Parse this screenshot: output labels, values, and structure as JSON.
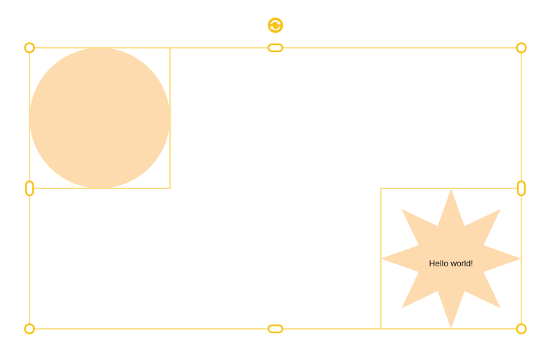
{
  "canvas": {
    "shapes": [
      {
        "type": "circle",
        "fill": "#fddbae"
      },
      {
        "type": "star",
        "points": 8,
        "fill": "#fddbae",
        "text": "Hello world!"
      }
    ],
    "selection": {
      "stroke_color": "#fbe08a",
      "handle_color": "#f6c31c",
      "rotate_icon": "rotate-icon"
    }
  }
}
